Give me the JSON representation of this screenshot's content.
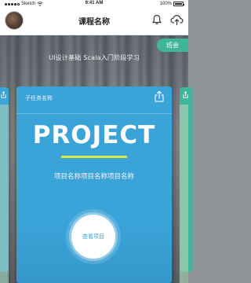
{
  "status_bar": {
    "carrier": "Sketch",
    "time": "9:41 AM",
    "battery": "100%"
  },
  "header": {
    "title": "课程名称"
  },
  "tag": {
    "label": "班会"
  },
  "subtitle": "UI设计基础   Scala入门阶段学习",
  "card": {
    "subtask_name": "子任务名称",
    "project_title": "PROJECT",
    "description": "项目名称项目名称项目名称",
    "view_button": "查看项目"
  },
  "colors": {
    "card_blue": "#3aa3d8",
    "accent_green": "#3fb59a",
    "underline_yellow": "#d4ea45"
  },
  "icons": [
    "avatar",
    "bell-icon",
    "cloud-upload-icon",
    "share-icon",
    "wifi-icon"
  ]
}
